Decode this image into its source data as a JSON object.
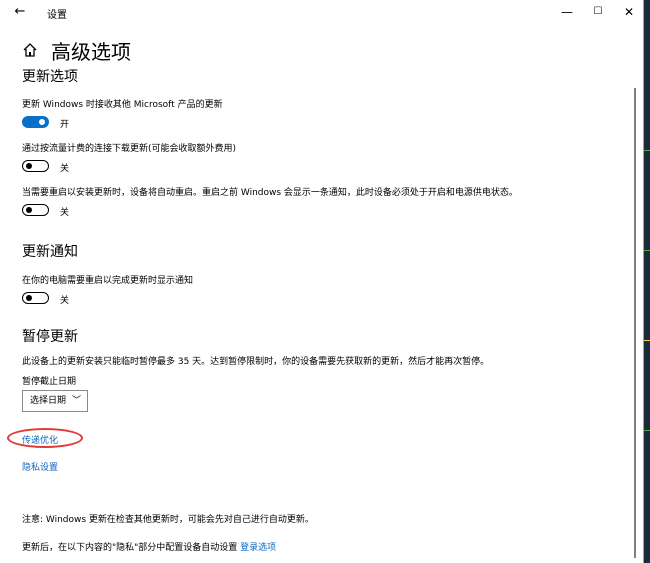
{
  "window": {
    "title": "设置",
    "back_glyph": "←",
    "minimize_glyph": "—",
    "maximize_glyph": "☐",
    "close_glyph": "✕"
  },
  "page": {
    "title": "高级选项",
    "home_icon": "home-icon"
  },
  "update_options": {
    "heading": "更新选项",
    "items": [
      {
        "label": "更新 Windows 时接收其他 Microsoft 产品的更新",
        "state_text": "开",
        "on": true
      },
      {
        "label": "通过按流量计费的连接下载更新(可能会收取额外费用)",
        "state_text": "关",
        "on": false
      },
      {
        "label": "当需要重启以安装更新时，设备将自动重启。重启之前 Windows 会显示一条通知，此时设备必须处于开启和电源供电状态。",
        "state_text": "关",
        "on": false
      }
    ]
  },
  "update_notifications": {
    "heading": "更新通知",
    "item": {
      "label": "在你的电脑需要重启以完成更新时显示通知",
      "state_text": "关",
      "on": false
    }
  },
  "pause_updates": {
    "heading": "暂停更新",
    "description": "此设备上的更新安装只能临时暂停最多 35 天。达到暂停限制时，你的设备需要先获取新的更新，然后才能再次暂停。",
    "date_label": "暂停截止日期",
    "dropdown_value": "选择日期"
  },
  "links": {
    "delivery_optimization": "传递优化",
    "privacy_settings": "隐私设置"
  },
  "notes": {
    "note1": "注意: Windows 更新在检查其他更新时，可能会先对自己进行自动更新。",
    "note2_prefix": "更新后，在以下内容的\"隐私\"部分中配置设备自动设置 ",
    "note2_link": "登录选项"
  },
  "colors": {
    "accent": "#0a6fc9",
    "link": "#0a66c2",
    "annotation": "#e53935"
  }
}
